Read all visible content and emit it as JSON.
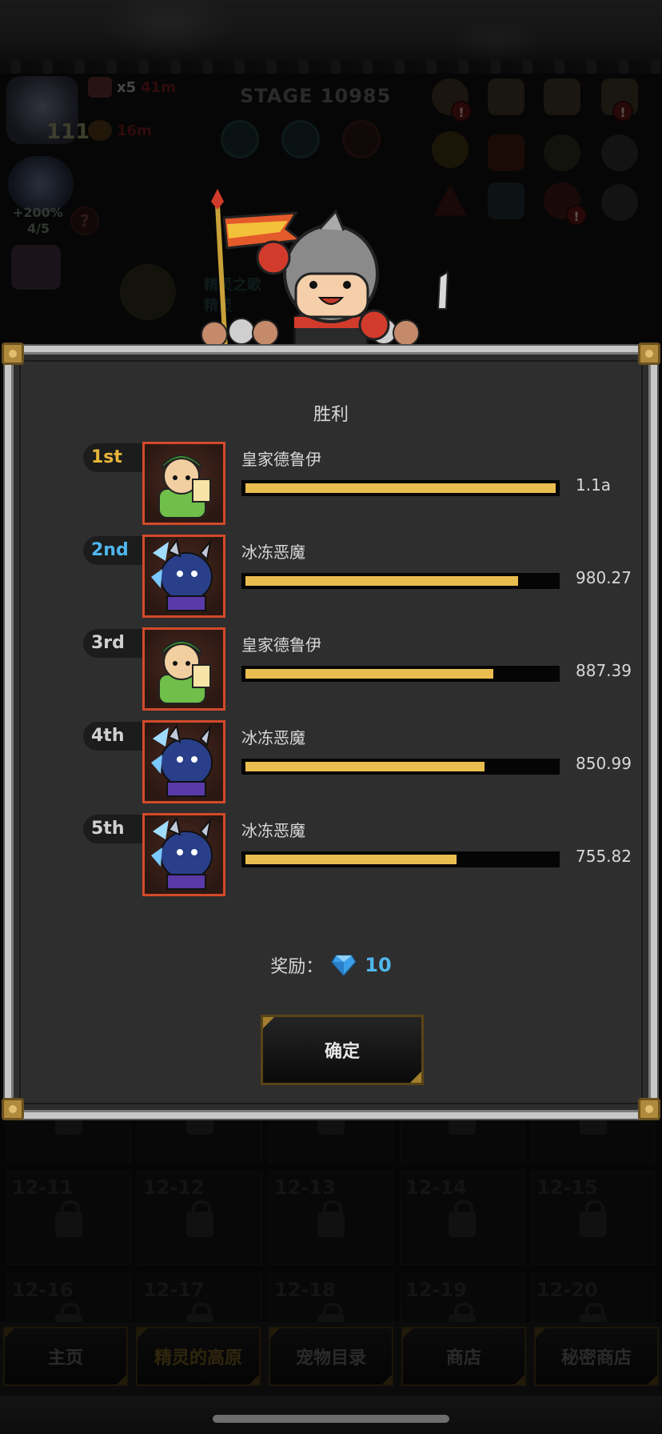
{
  "header": {
    "stage": "STAGE 10985",
    "player_level": "111",
    "resources": [
      {
        "icon": "ticket-icon",
        "multiplier": "x5",
        "value": "41m"
      },
      {
        "icon": "coin-icon",
        "multiplier": "",
        "value": "16m"
      }
    ],
    "boost": {
      "percent": "+200%",
      "ratio": "4/5"
    },
    "help": "?",
    "banner_lines": [
      "精灵之歌",
      "精灵"
    ]
  },
  "modal": {
    "title": "胜利",
    "rankings": [
      {
        "rank": "1st",
        "name": "皇家德鲁伊",
        "damage": "1.1a",
        "fill": 1.0,
        "hero": "druid"
      },
      {
        "rank": "2nd",
        "name": "冰冻恶魔",
        "damage": "980.27",
        "fill": 0.88,
        "hero": "demon"
      },
      {
        "rank": "3rd",
        "name": "皇家德鲁伊",
        "damage": "887.39",
        "fill": 0.8,
        "hero": "druid"
      },
      {
        "rank": "4th",
        "name": "冰冻恶魔",
        "damage": "850.99",
        "fill": 0.77,
        "hero": "demon"
      },
      {
        "rank": "5th",
        "name": "冰冻恶魔",
        "damage": "755.82",
        "fill": 0.68,
        "hero": "demon"
      }
    ],
    "reward_label": "奖励：",
    "reward_value": "10",
    "confirm_label": "确定"
  },
  "grid": {
    "labels": [
      "",
      "",
      "",
      "",
      "",
      "12-11",
      "12-12",
      "12-13",
      "12-14",
      "12-15",
      "12-16",
      "12-17",
      "12-18",
      "12-19",
      "12-20"
    ]
  },
  "nav": {
    "items": [
      {
        "label": "主页",
        "active": false
      },
      {
        "label": "精灵的高原",
        "active": true
      },
      {
        "label": "宠物目录",
        "active": false
      },
      {
        "label": "商店",
        "active": false
      },
      {
        "label": "秘密商店",
        "active": false
      }
    ]
  },
  "colors": {
    "gold": "#e8b53a",
    "blue": "#4fb6ec",
    "bar": "#e9bd4f",
    "portrait_border": "#d34a2a"
  }
}
